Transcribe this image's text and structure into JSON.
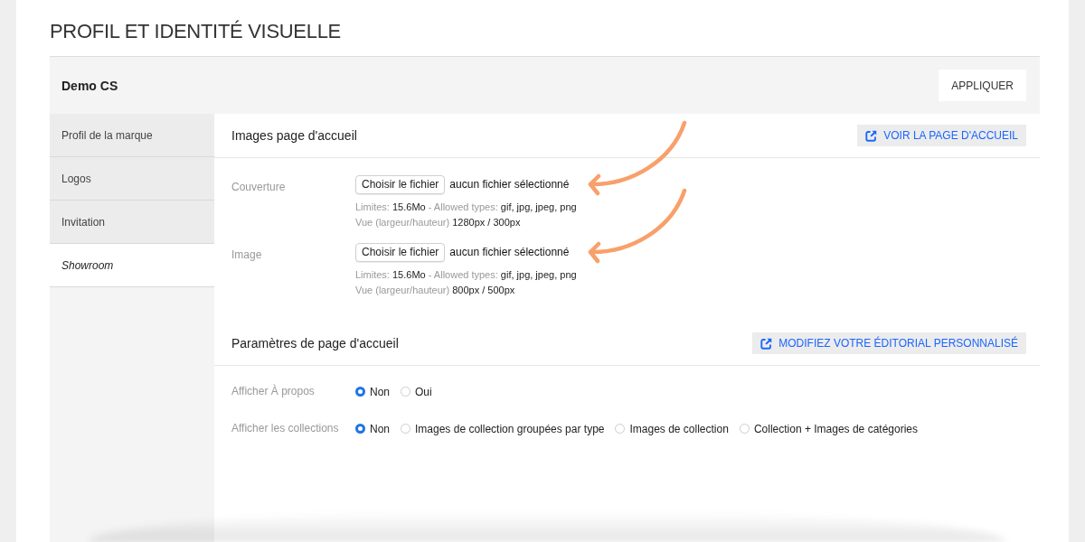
{
  "page": {
    "title": "PROFIL ET IDENTITÉ VISUELLE"
  },
  "header": {
    "account": "Demo CS",
    "apply_button": "APPLIQUER"
  },
  "sidebar": {
    "items": [
      {
        "label": "Profil de la marque",
        "selected": false
      },
      {
        "label": "Logos",
        "selected": false
      },
      {
        "label": "Invitation",
        "selected": false
      },
      {
        "label": "Showroom",
        "selected": true
      }
    ]
  },
  "sections": [
    {
      "title": "Images page d'accueil",
      "link_button": "VOIR LA PAGE D'ACCUEIL",
      "fields": [
        {
          "kind": "file",
          "label": "Couverture",
          "button": "Choisir le fichier",
          "status": "aucun fichier sélectionné",
          "arrow": true,
          "hint_lines": [
            [
              {
                "kind": "label",
                "text": "Limites:"
              },
              {
                "kind": "value",
                "text": "15.6Mo"
              },
              {
                "kind": "label",
                "text": "- Allowed types:"
              },
              {
                "kind": "value",
                "text": "gif, jpg, jpeg, png"
              }
            ],
            [
              {
                "kind": "label",
                "text": "Vue (largeur/hauteur)"
              },
              {
                "kind": "value",
                "text": "1280px / 300px"
              }
            ]
          ]
        },
        {
          "kind": "file",
          "label": "Image",
          "button": "Choisir le fichier",
          "status": "aucun fichier sélectionné",
          "arrow": true,
          "hint_lines": [
            [
              {
                "kind": "label",
                "text": "Limites:"
              },
              {
                "kind": "value",
                "text": "15.6Mo"
              },
              {
                "kind": "label",
                "text": "- Allowed types:"
              },
              {
                "kind": "value",
                "text": "gif, jpg, jpeg, png"
              }
            ],
            [
              {
                "kind": "label",
                "text": "Vue (largeur/hauteur)"
              },
              {
                "kind": "value",
                "text": "800px / 500px"
              }
            ]
          ]
        }
      ]
    },
    {
      "title": "Paramètres de page d'accueil",
      "link_button": "MODIFIEZ VOTRE ÉDITORIAL PERSONNALISÉ",
      "fields": [
        {
          "kind": "radio",
          "label": "Afficher À propos",
          "options": [
            {
              "label": "Non",
              "selected": true
            },
            {
              "label": "Oui",
              "selected": false
            }
          ]
        },
        {
          "kind": "radio",
          "label": "Afficher les collections",
          "options": [
            {
              "label": "Non",
              "selected": true
            },
            {
              "label": "Images de collection groupées par type",
              "selected": false
            },
            {
              "label": "Images de collection",
              "selected": false
            },
            {
              "label": "Collection + Images de catégories",
              "selected": false
            }
          ]
        }
      ]
    }
  ]
}
